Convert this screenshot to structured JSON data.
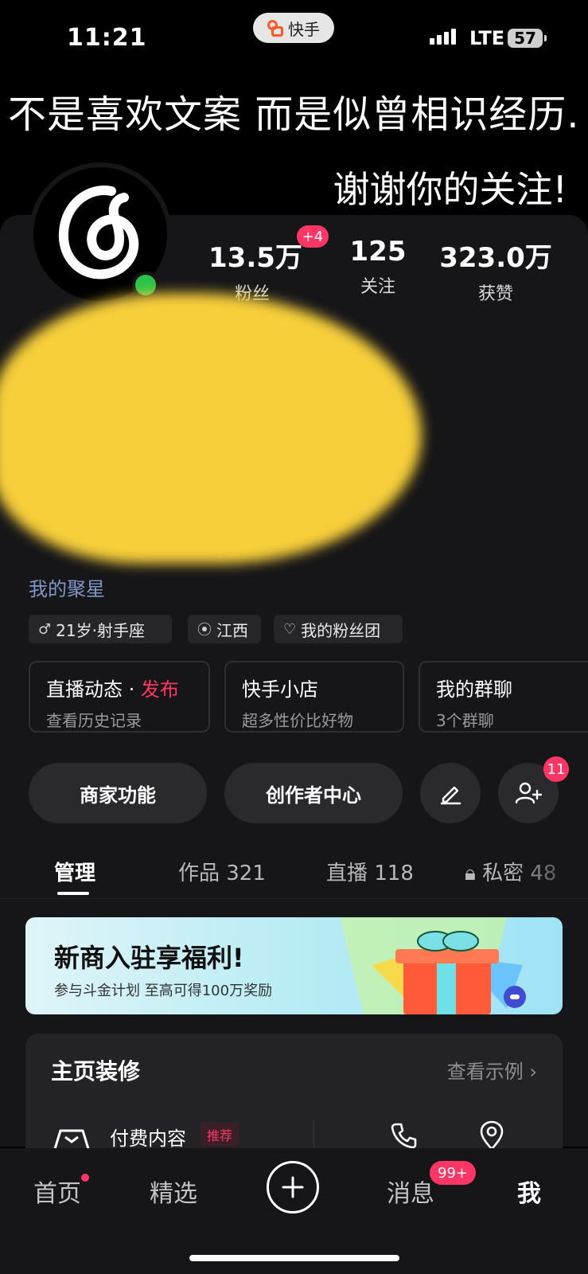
{
  "status_bar": {
    "time": "11:21",
    "app_pill": "快手",
    "network": "LTE",
    "battery": "57"
  },
  "banner": {
    "line1": "不是喜欢文案 而是似曾相识经历.",
    "line2": "谢谢你的关注!"
  },
  "stats": [
    {
      "value": "13.5万",
      "label": "粉丝",
      "badge": "+4"
    },
    {
      "value": "125",
      "label": "关注"
    },
    {
      "value": "323.0万",
      "label": "获赞"
    }
  ],
  "profile": {
    "juxing_link": "我的聚星"
  },
  "tags": [
    "21岁·射手座",
    "江西",
    "我的粉丝团"
  ],
  "features": [
    {
      "title": "直播动态 · ",
      "title_hot": "发布",
      "subtitle": "查看历史记录"
    },
    {
      "title": "快手小店",
      "subtitle": "超多性价比好物"
    },
    {
      "title": "我的群聊",
      "subtitle": "3个群聊"
    }
  ],
  "actions": {
    "merchant": "商家功能",
    "creator": "创作者中心",
    "add_friend_badge": "11"
  },
  "tabs": [
    {
      "label": "管理"
    },
    {
      "label": "作品 321"
    },
    {
      "label": "直播 118"
    },
    {
      "label": "私密 48"
    }
  ],
  "promo": {
    "title": "新商入驻享福利!",
    "subtitle": "参与斗金计划 至高可得100万奖励"
  },
  "decor": {
    "title": "主页装修",
    "example": "查看示例 ›",
    "paid": "付费内容",
    "recommend": "推荐"
  },
  "bottom_nav": {
    "home": "首页",
    "featured": "精选",
    "messages": "消息",
    "messages_badge": "99+",
    "me": "我"
  },
  "colors": {
    "accent": "#fe3666",
    "online": "#2bc24a",
    "link": "#7f96c8"
  }
}
